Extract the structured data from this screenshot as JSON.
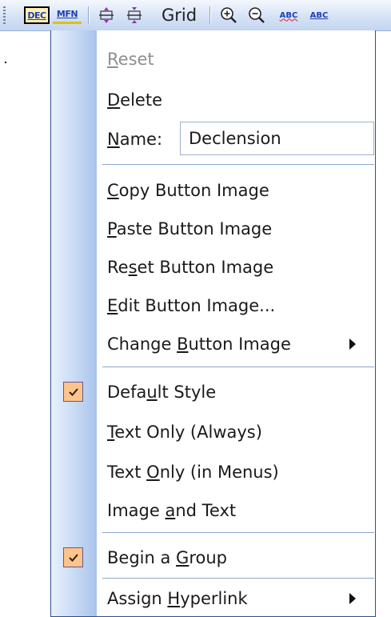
{
  "toolbar": {
    "dec_label": "DEC",
    "mfn_label": "MFN",
    "grid_label": "Grid",
    "abc1_label": "ABC",
    "abc2_label": "ABC",
    "icons": [
      "row-spacing-icon",
      "column-spacing-icon",
      "zoom-in-icon",
      "zoom-out-icon"
    ]
  },
  "menu": {
    "reset": {
      "pre": "",
      "key": "R",
      "post": "eset"
    },
    "delete": {
      "pre": "",
      "key": "D",
      "post": "elete"
    },
    "name": {
      "pre": "",
      "key": "N",
      "post": "ame:",
      "value": "Declension"
    },
    "copy_button_image": {
      "pre": "",
      "key": "C",
      "post": "opy Button Image"
    },
    "paste_button_image": {
      "pre": "",
      "key": "P",
      "post": "aste Button Image"
    },
    "reset_button_image": {
      "pre": "Re",
      "key": "s",
      "post": "et Button Image"
    },
    "edit_button_image": {
      "pre": "",
      "key": "E",
      "post": "dit Button Image..."
    },
    "change_button_image": {
      "pre": "Change ",
      "key": "B",
      "post": "utton Image"
    },
    "default_style": {
      "pre": "Defa",
      "key": "u",
      "post": "lt Style",
      "checked": true
    },
    "text_only_always": {
      "pre": "",
      "key": "T",
      "post": "ext Only (Always)"
    },
    "text_only_menus": {
      "pre": "Text ",
      "key": "O",
      "post": "nly (in Menus)"
    },
    "image_and_text": {
      "pre": "Image ",
      "key": "a",
      "post": "nd Text"
    },
    "begin_group": {
      "pre": "Begin a ",
      "key": "G",
      "post": "roup",
      "checked": true
    },
    "assign_hyperlink": {
      "pre": "Assign ",
      "key": "H",
      "post": "yperlink"
    }
  },
  "colors": {
    "gutter": "#c6d9f3",
    "check_bg": "#ffc48a",
    "separator": "#8da7cf",
    "accent_text": "#1b3fb8"
  }
}
